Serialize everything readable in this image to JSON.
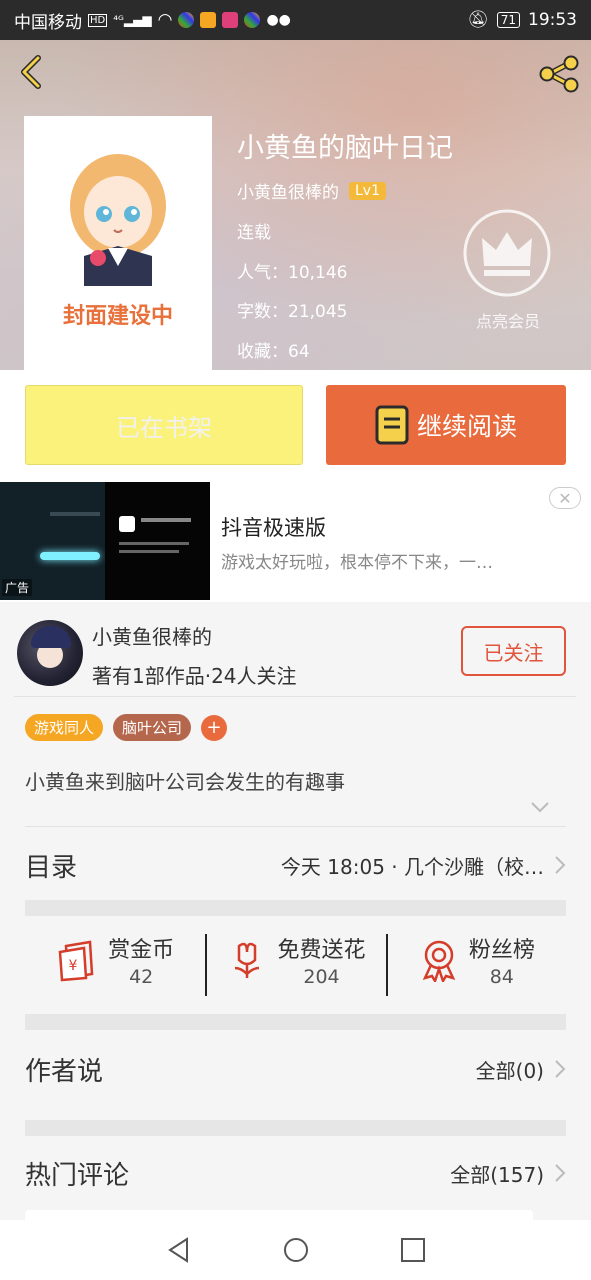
{
  "status_bar": {
    "carrier": "中国移动",
    "battery": "71",
    "time": "19:53"
  },
  "book": {
    "title": "小黄鱼的脑叶日记",
    "author": "小黄鱼很棒的",
    "author_level": "Lv1",
    "status": "连载",
    "popularity": "人气：10,146",
    "word_count": "字数：21,045",
    "favorites": "收藏：64",
    "cover_text": "封面建设中",
    "vip_label": "点亮会员"
  },
  "actions": {
    "shelf_label": "已在书架",
    "read_label": "继续阅读"
  },
  "ad": {
    "title": "抖音极速版",
    "description": "游戏太好玩啦，根本停不下来，一…",
    "tag": "广告",
    "close": "✕"
  },
  "author_card": {
    "name": "小黄鱼很棒的",
    "meta": "著有1部作品·24人关注",
    "follow_label": "已关注"
  },
  "tags": [
    {
      "label": "游戏同人",
      "color": "#f5a623"
    },
    {
      "label": "脑叶公司",
      "color": "#b5674e"
    }
  ],
  "tag_add": "+",
  "intro": "小黄鱼来到脑叶公司会发生的有趣事",
  "catalog": {
    "title": "目录",
    "latest": "今天 18:05 · 几个沙雕（校…"
  },
  "stats": [
    {
      "label": "赏金币",
      "value": "42",
      "icon": "red-envelope-icon"
    },
    {
      "label": "免费送花",
      "value": "204",
      "icon": "flower-icon"
    },
    {
      "label": "粉丝榜",
      "value": "84",
      "icon": "medal-icon"
    }
  ],
  "author_says": {
    "title": "作者说",
    "all": "全部(0)"
  },
  "hot_comments": {
    "title": "热门评论",
    "all": "全部(157)"
  },
  "colors": {
    "accent": "#e96b3d",
    "shelf": "#fbf27c",
    "follow": "#e0553c"
  }
}
